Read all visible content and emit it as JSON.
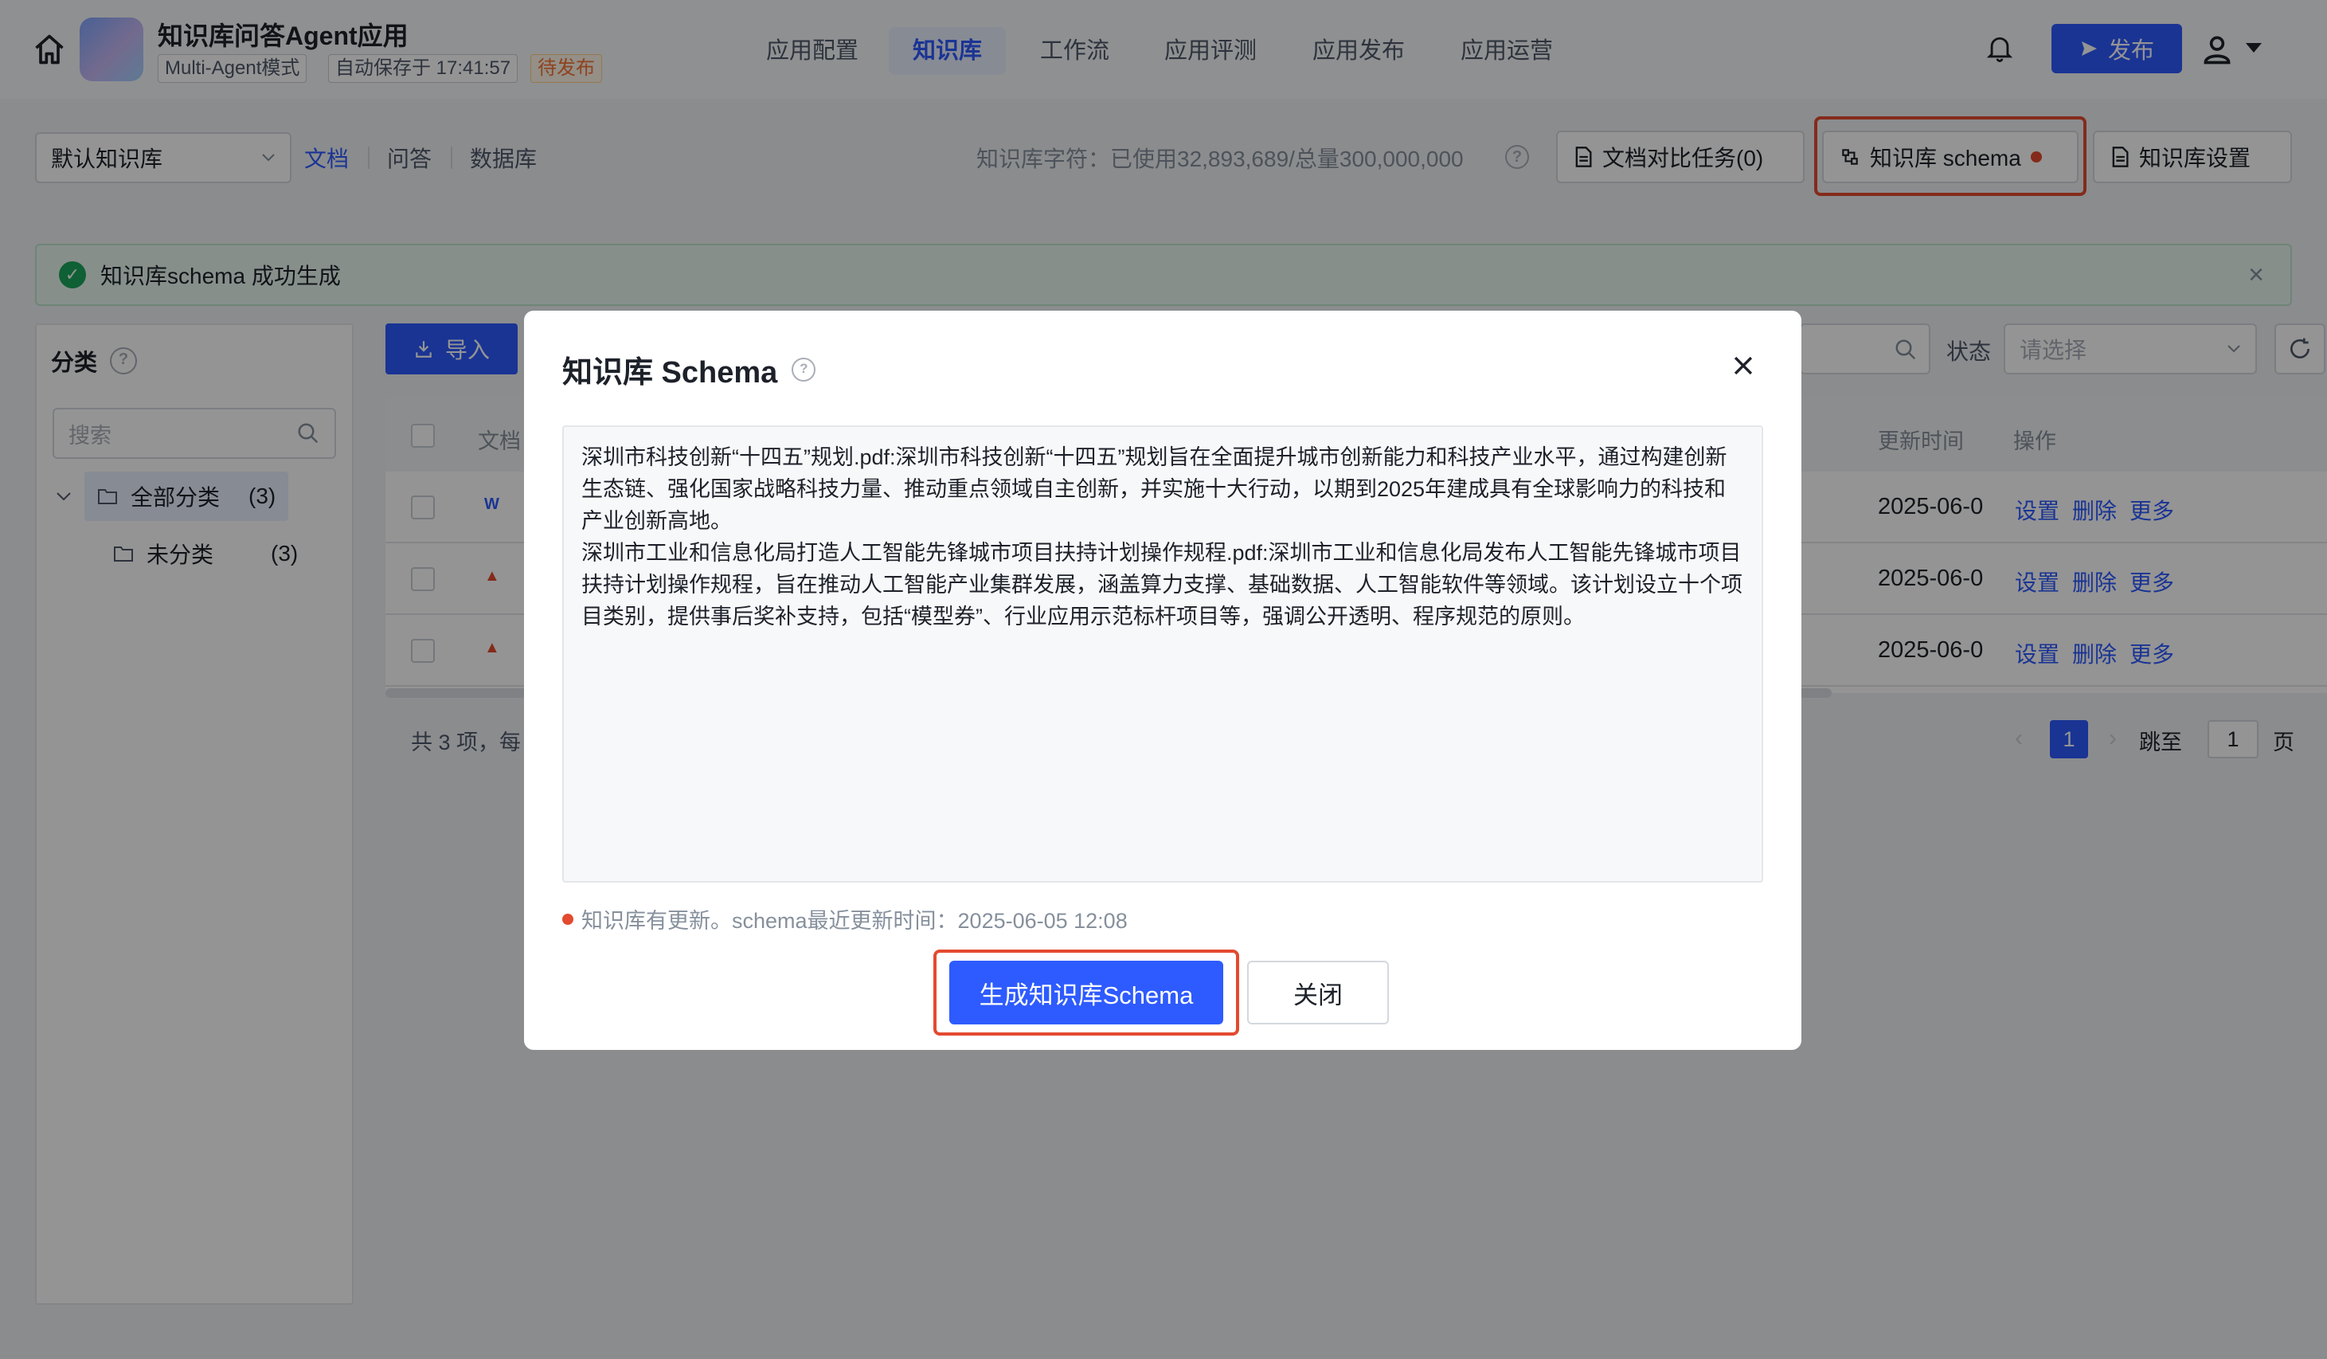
{
  "header": {
    "app_name": "知识库问答Agent应用",
    "mode_tag": "Multi-Agent模式",
    "autosave_tag": "自动保存于 17:41:57",
    "status_tag": "待发布",
    "nav_tabs": [
      {
        "label": "应用配置",
        "active": false
      },
      {
        "label": "知识库",
        "active": true
      },
      {
        "label": "工作流",
        "active": false
      },
      {
        "label": "应用评测",
        "active": false
      },
      {
        "label": "应用发布",
        "active": false
      },
      {
        "label": "应用运营",
        "active": false
      }
    ],
    "publish_label": "发布"
  },
  "toolbar": {
    "kb_select_value": "默认知识库",
    "sub_tabs": [
      {
        "label": "文档",
        "active": true
      },
      {
        "label": "问答",
        "active": false
      },
      {
        "label": "数据库",
        "active": false
      }
    ],
    "usage_text": "知识库字符：已使用32,893,689/总量300,000,000",
    "compare_task_label": "文档对比任务(0)",
    "schema_label": "知识库 schema",
    "settings_label": "知识库设置"
  },
  "alert": {
    "message": "知识库schema 成功生成"
  },
  "sidebar": {
    "title": "分类",
    "search_placeholder": "搜索",
    "tree": [
      {
        "label": "全部分类",
        "count": "(3)"
      },
      {
        "label": "未分类",
        "count": "(3)"
      }
    ]
  },
  "table": {
    "import_label": "导入",
    "columns": {
      "doc": "文档",
      "updated": "更新时间",
      "ops": "操作"
    },
    "rows": [
      {
        "file_type": "word",
        "updated": "2025-06-0"
      },
      {
        "file_type": "pdf",
        "updated": "2025-06-0"
      },
      {
        "file_type": "pdf",
        "updated": "2025-06-0"
      }
    ],
    "op_labels": {
      "settings": "设置",
      "delete": "删除",
      "more": "更多"
    },
    "status_label": "状态",
    "status_placeholder": "请选择",
    "footer_text": "共 3 项，每",
    "pagination": {
      "current": "1",
      "jump_label": "跳至",
      "jump_value": "1",
      "page_suffix": "页"
    }
  },
  "modal": {
    "title": "知识库 Schema",
    "schema_paragraphs": [
      "深圳市科技创新“十四五”规划.pdf:深圳市科技创新“十四五”规划旨在全面提升城市创新能力和科技产业水平，通过构建创新生态链、强化国家战略科技力量、推动重点领域自主创新，并实施十大行动，以期到2025年建成具有全球影响力的科技和产业创新高地。",
      "深圳市工业和信息化局打造人工智能先锋城市项目扶持计划操作规程.pdf:深圳市工业和信息化局发布人工智能先锋城市项目扶持计划操作规程，旨在推动人工智能产业集群发展，涵盖算力支撑、基础数据、人工智能软件等领域。该计划设立十个项目类别，提供事后奖补支持，包括“模型券”、行业应用示范标杆项目等，强调公开透明、程序规范的原则。"
    ],
    "update_note": "知识库有更新。schema最近更新时间：2025-06-05 12:08",
    "generate_label": "生成知识库Schema",
    "close_label": "关闭"
  },
  "colors": {
    "primary": "#2e5bff",
    "highlight": "#e34a2f",
    "success": "#1aa55a",
    "warning": "#f77234"
  }
}
